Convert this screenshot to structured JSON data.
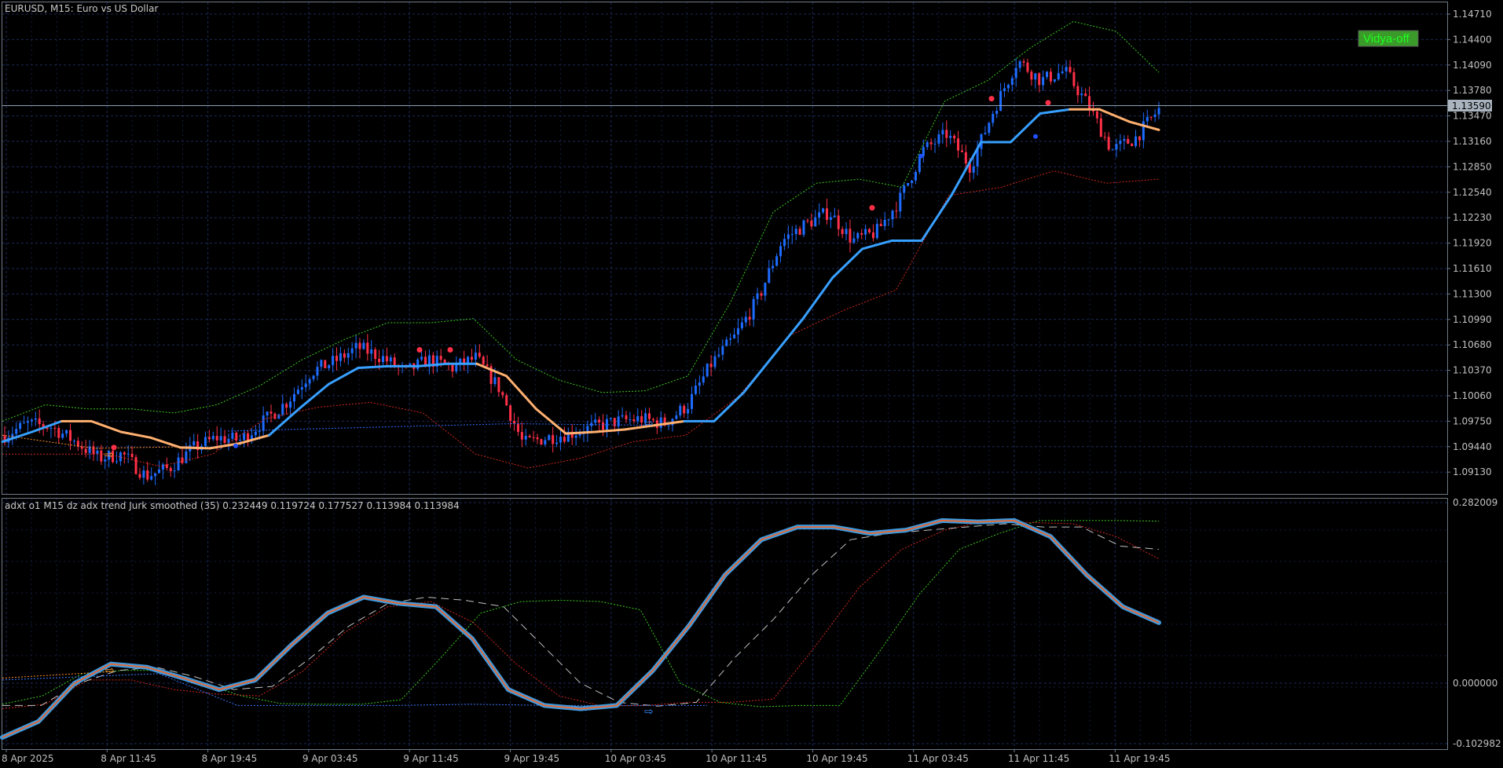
{
  "main_chart": {
    "title": "EURUSD, M15:  Euro vs US Dollar",
    "badge": "Vidya-off",
    "current_price": "1.13590",
    "colors": {
      "bull_candle": "#1e6cff",
      "bear_candle": "#ff3048",
      "vidya_up": "#38a0ff",
      "vidya_down": "#ffb070",
      "band_upper": "#3ccc1e",
      "band_lower": "#d0281e",
      "bid_line": "#8aa0b4"
    }
  },
  "indicator": {
    "title": "adxt o1 M15 dz adx trend Jurk smoothed (35) 0.232449 0.119724 0.177527 0.113984 0.113984"
  },
  "chart_data": [
    {
      "type": "candlestick",
      "symbol": "EURUSD",
      "timeframe": "M15",
      "ylim": [
        1.0895,
        1.1485
      ],
      "y_ticks": [
        "1.14710",
        "1.14400",
        "1.14090",
        "1.13780",
        "1.13470",
        "1.13160",
        "1.12850",
        "1.12540",
        "1.12230",
        "1.11920",
        "1.11610",
        "1.11300",
        "1.10990",
        "1.10680",
        "1.10370",
        "1.10060",
        "1.09750",
        "1.09440",
        "1.09130"
      ],
      "x_ticks": [
        "8 Apr 2025",
        "8 Apr 11:45",
        "8 Apr 19:45",
        "9 Apr 03:45",
        "9 Apr 11:45",
        "9 Apr 19:45",
        "10 Apr 03:45",
        "10 Apr 11:45",
        "10 Apr 19:45",
        "11 Apr 03:45",
        "11 Apr 11:45",
        "11 Apr 19:45"
      ],
      "close_path": [
        1.0958,
        1.0972,
        1.0968,
        1.095,
        1.093,
        1.0935,
        1.0908,
        1.0918,
        1.0942,
        1.0955,
        1.0952,
        1.0975,
        1.0999,
        1.1035,
        1.1048,
        1.1065,
        1.1053,
        1.1035,
        1.105,
        1.104,
        1.1052,
        1.1015,
        1.0948,
        1.0955,
        1.096,
        1.0968,
        1.0975,
        1.0978,
        1.0972,
        1.0995,
        1.1045,
        1.1078,
        1.1125,
        1.1195,
        1.1215,
        1.123,
        1.1195,
        1.1205,
        1.1245,
        1.1305,
        1.1325,
        1.1285,
        1.1355,
        1.1415,
        1.139,
        1.1402,
        1.136,
        1.1305,
        1.132,
        1.1355
      ],
      "vidya": [
        1.095,
        1.0962,
        1.0975,
        1.0975,
        1.0962,
        1.0955,
        1.0943,
        1.0942,
        1.0948,
        1.0958,
        1.099,
        1.102,
        1.104,
        1.1042,
        1.1042,
        1.1045,
        1.1045,
        1.103,
        1.099,
        1.096,
        1.0962,
        1.0965,
        1.097,
        1.0975,
        1.0975,
        1.101,
        1.1055,
        1.11,
        1.115,
        1.1185,
        1.1195,
        1.1195,
        1.125,
        1.1315,
        1.1315,
        1.135,
        1.1355,
        1.1355,
        1.134,
        1.133
      ],
      "band_upper": [
        1.0975,
        1.0995,
        1.099,
        1.099,
        1.0985,
        1.0995,
        1.1018,
        1.105,
        1.1075,
        1.1095,
        1.1095,
        1.11,
        1.105,
        1.1025,
        1.101,
        1.1012,
        1.103,
        1.112,
        1.123,
        1.1265,
        1.127,
        1.126,
        1.1365,
        1.139,
        1.143,
        1.1462,
        1.145,
        1.14
      ],
      "band_lower": [
        1.0935,
        1.0935,
        1.0935,
        1.092,
        1.0935,
        1.0978,
        1.0992,
        1.0998,
        1.0985,
        1.0935,
        1.0918,
        1.093,
        1.095,
        1.0958,
        1.1005,
        1.108,
        1.111,
        1.1135,
        1.125,
        1.126,
        1.128,
        1.1265,
        1.127
      ],
      "signals_red": [
        [
          1.0943
        ],
        [
          1.1062
        ],
        [
          1.1062
        ],
        [
          1.1235
        ],
        [
          1.1368
        ],
        [
          1.1363
        ]
      ],
      "signals_blue": [
        [
          1.0945
        ],
        [
          1.1298
        ],
        [
          1.1322
        ]
      ]
    },
    {
      "type": "line",
      "ylim": [
        -0.102982,
        0.282009
      ],
      "y_ticks": [
        "0.282009",
        "0.000000",
        "-0.102982"
      ],
      "series": [
        {
          "values": [
            -0.085,
            -0.06,
            0.0,
            0.03,
            0.025,
            0.008,
            -0.01,
            0.005,
            0.06,
            0.11,
            0.135,
            0.125,
            0.12,
            0.07,
            -0.01,
            -0.035,
            -0.04,
            -0.035,
            0.02,
            0.09,
            0.17,
            0.225,
            0.245,
            0.245,
            0.235,
            0.24,
            0.255,
            0.253,
            0.255,
            0.23,
            0.17,
            0.12,
            0.095
          ]
        },
        {
          "values": [
            -0.035,
            -0.035,
            0.0,
            0.02,
            0.025,
            0.01,
            -0.01,
            -0.005,
            0.04,
            0.09,
            0.125,
            0.135,
            0.13,
            0.12,
            0.06,
            0.0,
            -0.03,
            -0.036,
            -0.03,
            0.04,
            0.1,
            0.17,
            0.225,
            0.235,
            0.24,
            0.245,
            0.25,
            0.245,
            0.245,
            0.215,
            0.21
          ]
        },
        {
          "values": [
            -0.04,
            -0.033,
            0.005,
            0.005,
            -0.01,
            -0.017,
            -0.02,
            0.018,
            0.08,
            0.12,
            0.128,
            0.095,
            0.03,
            -0.02,
            -0.036,
            -0.035,
            -0.03,
            -0.03,
            -0.025,
            0.06,
            0.15,
            0.21,
            0.24,
            0.255,
            0.252,
            0.25,
            0.23,
            0.195
          ]
        },
        {
          "values": [
            -0.033,
            -0.02,
            0.015,
            0.02,
            0.02,
            0.0,
            -0.02,
            -0.032,
            -0.033,
            -0.033,
            -0.026,
            0.04,
            0.11,
            0.128,
            0.13,
            0.128,
            0.115,
            0.0,
            -0.03,
            -0.037,
            -0.035,
            -0.035,
            0.05,
            0.14,
            0.21,
            0.235,
            0.255,
            0.255,
            0.255,
            0.254
          ]
        },
        {
          "values": [
            0.005,
            0.01,
            0.015,
            -0.035,
            -0.035,
            -0.035,
            -0.033,
            -0.035,
            -0.035,
            -0.035
          ]
        }
      ],
      "signal_arrows": [
        0.02,
        -0.04
      ]
    }
  ]
}
